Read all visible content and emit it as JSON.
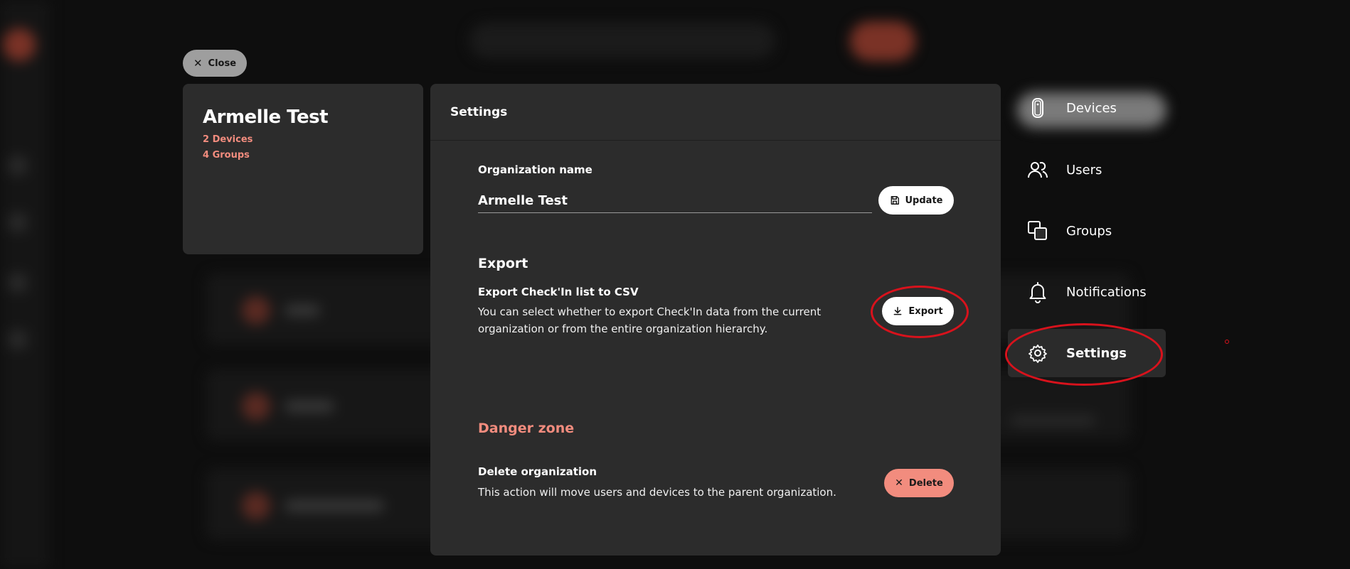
{
  "close_label": "Close",
  "org": {
    "name": "Armelle Test",
    "devices_count": "2 Devices",
    "groups_count": "4 Groups"
  },
  "settings": {
    "title": "Settings",
    "org_name_label": "Organization name",
    "org_name_value": "Armelle Test",
    "update_label": "Update",
    "export_title": "Export",
    "export_subtitle": "Export Check'In list to CSV",
    "export_description": "You can select whether to export Check'In data from the current organization or from the entire organization hierarchy.",
    "export_label": "Export",
    "danger_title": "Danger zone",
    "delete_subtitle": "Delete organization",
    "delete_description": "This action will move users and devices to the parent organization.",
    "delete_label": "Delete"
  },
  "nav": {
    "items": [
      {
        "label": "Devices",
        "icon": "device-icon"
      },
      {
        "label": "Users",
        "icon": "users-icon"
      },
      {
        "label": "Groups",
        "icon": "groups-icon"
      },
      {
        "label": "Notifications",
        "icon": "bell-icon"
      },
      {
        "label": "Settings",
        "icon": "gear-icon",
        "active": true
      }
    ]
  },
  "colors": {
    "accent": "#f28c7e",
    "annotation": "#d8121c",
    "panel": "#2c2c2c"
  }
}
